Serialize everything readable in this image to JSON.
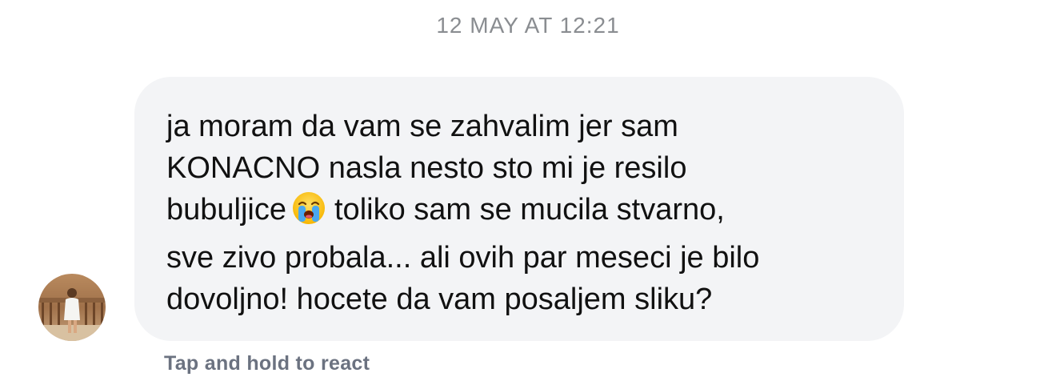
{
  "timestamp": "12 MAY AT 12:21",
  "message": {
    "line1": "ja moram da vam se zahvalim jer sam",
    "line2": "KONACNO nasla nesto sto mi je resilo",
    "line3_before": "bubuljice",
    "line3_after": "toliko sam se mucila stvarno,",
    "line4": "sve zivo probala... ali ovih par meseci je bilo",
    "line5": "dovoljno! hocete da vam posaljem sliku?",
    "emoji": "loudly-crying-face-emoji"
  },
  "react_hint": "Tap and hold to react",
  "colors": {
    "bubble_bg": "#f3f4f6",
    "timestamp": "#8a8d91",
    "hint": "#6b7280",
    "text": "#111111"
  }
}
